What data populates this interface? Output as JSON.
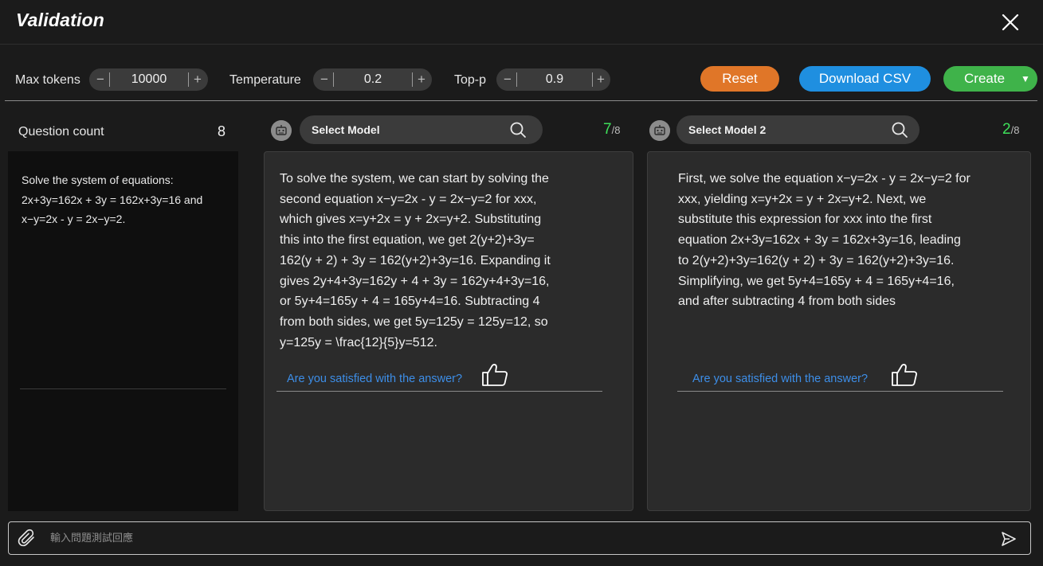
{
  "header": {
    "title": "Validation"
  },
  "params": {
    "max_tokens": {
      "label": "Max tokens",
      "value": "10000"
    },
    "temperature": {
      "label": "Temperature",
      "value": "0.2"
    },
    "top_p": {
      "label": "Top-p",
      "value": "0.9"
    },
    "minus": "−",
    "plus": "+"
  },
  "actions": {
    "reset": "Reset",
    "download_csv": "Download CSV",
    "create": "Create",
    "create_caret": "▼"
  },
  "question": {
    "count_label": "Question count",
    "count": "8",
    "text": "Solve the system of equations: 2x+3y=162x + 3y = 162x+3y=16 and x−y=2x - y = 2x−y=2."
  },
  "models": [
    {
      "name": "Select Model",
      "score": "7",
      "score_total": "/8",
      "answer": "To solve the system, we can start by solving the\nsecond equation x−y=2x - y = 2x−y=2 for xxx,\n which gives x=y+2x = y + 2x=y+2. Substituting\nthis into the first equation, we get 2(y+2)+3y=\n162(y + 2) + 3y = 162(y+2)+3y=16. Expanding it\ngives 2y+4+3y=162y + 4 + 3y = 162y+4+3y=16,\n or 5y+4=165y + 4 = 165y+4=16. Subtracting 4\nfrom both sides, we get 5y=125y = 125y=12, so\ny=125y = \\frac{12}{5}y=512.",
      "satisfaction": "Are you satisfied with the answer?"
    },
    {
      "name": "Select Model 2",
      "score": "2",
      "score_total": "/8",
      "answer": "First, we solve the equation x−y=2x - y = 2x−y=2 for\nxxx, yielding x=y+2x = y + 2x=y+2. Next, we\nsubstitute this expression for xxx into the first\nequation 2x+3y=162x + 3y = 162x+3y=16, leading\nto 2(y+2)+3y=162(y + 2) + 3y = 162(y+2)+3y=16.\nSimplifying, we get 5y+4=165y + 4 = 165y+4=16,\nand after subtracting 4 from both sides",
      "satisfaction": "Are you satisfied with the answer?"
    }
  ],
  "chat": {
    "placeholder": "輸入問題測試回應"
  }
}
